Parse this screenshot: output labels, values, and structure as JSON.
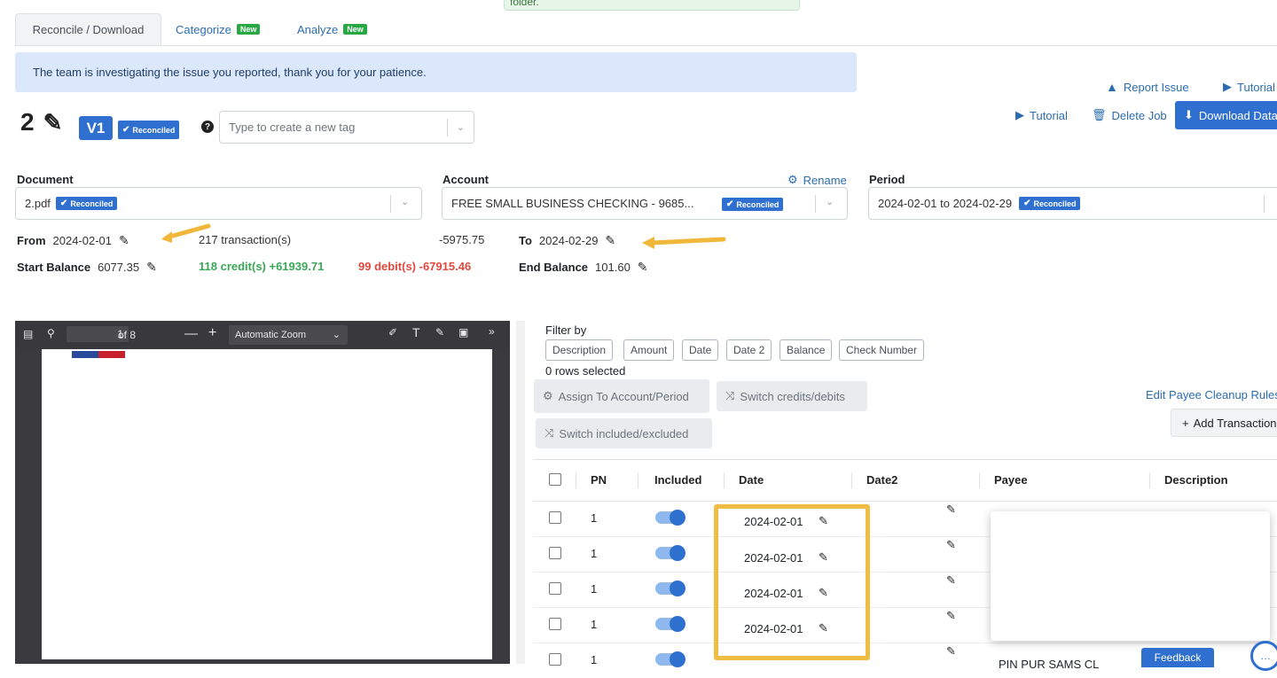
{
  "toast": {
    "text": "folder."
  },
  "tabs": [
    {
      "label": "Reconcile / Download",
      "badge": ""
    },
    {
      "label": "Categorize",
      "badge": "New"
    },
    {
      "label": "Analyze",
      "badge": "New"
    }
  ],
  "banner": {
    "text": "The team is investigating the issue you reported, thank you for your patience."
  },
  "header_links": {
    "report_issue": "Report Issue",
    "tutorial_top": "Tutorial",
    "tutorial": "Tutorial",
    "delete_job": "Delete Job",
    "download": "Download Data"
  },
  "job": {
    "name": "2",
    "version": "V1",
    "status": "Reconciled"
  },
  "tag_input": {
    "placeholder": "Type to create a new tag"
  },
  "document": {
    "label": "Document",
    "value": "2.pdf",
    "status": "Reconciled"
  },
  "account": {
    "label": "Account",
    "rename": "Rename",
    "value": "FREE SMALL BUSINESS CHECKING - 9685...",
    "status": "Reconciled"
  },
  "period": {
    "label": "Period",
    "value": "2024-02-01 to 2024-02-29",
    "status": "Reconciled"
  },
  "summary": {
    "from_label": "From",
    "from_value": "2024-02-01",
    "transactions": "217 transaction(s)",
    "net": "-5975.75",
    "to_label": "To",
    "to_value": "2024-02-29",
    "start_label": "Start Balance",
    "start_value": "6077.35",
    "credits": "118 credit(s) +61939.71",
    "debits": "99 debit(s) -67915.46",
    "end_label": "End Balance",
    "end_value": "101.60"
  },
  "pdf": {
    "page": "1",
    "of": "of 8",
    "zoom": "Automatic Zoom"
  },
  "filter": {
    "label": "Filter by",
    "chips": [
      "Description",
      "Amount",
      "Date",
      "Date 2",
      "Balance",
      "Check Number"
    ],
    "selected": "0 rows selected"
  },
  "actions": {
    "assign": "Assign To Account/Period",
    "switch_cd": "Switch credits/debits",
    "switch_ie": "Switch included/excluded",
    "edit_payee": "Edit Payee Cleanup Rules",
    "add_txn": "Add Transaction"
  },
  "columns": [
    "PN",
    "Included",
    "Date",
    "Date2",
    "Payee",
    "Description"
  ],
  "rows": [
    {
      "pn": "1",
      "date": "2024-02-01"
    },
    {
      "pn": "1",
      "date": "2024-02-01"
    },
    {
      "pn": "1",
      "date": "2024-02-01"
    },
    {
      "pn": "1",
      "date": "2024-02-01"
    },
    {
      "pn": "1",
      "date": "",
      "payee": "PIN PUR SAMS CL"
    }
  ],
  "feedback": "Feedback",
  "colors": {
    "accent": "#2f6fcf",
    "credit": "#3aa757",
    "debit": "#e0483e",
    "highlight": "#efbd44"
  }
}
